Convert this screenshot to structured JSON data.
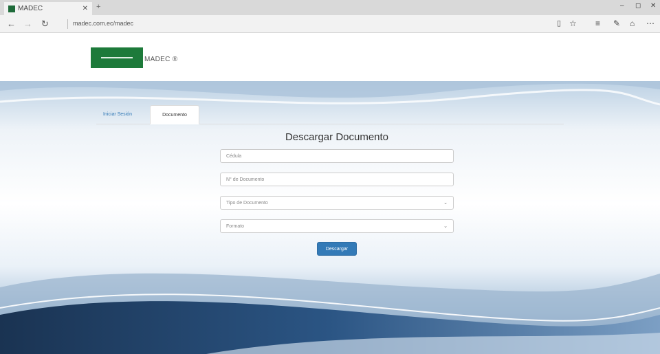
{
  "browser": {
    "tab_title": "MADEC",
    "url": "madec.com.ec/madec"
  },
  "header": {
    "brand": "MADEC ®"
  },
  "nav": {
    "tabs": [
      {
        "label": "Iniciar Sesión"
      },
      {
        "label": "Documento"
      }
    ]
  },
  "form": {
    "title": "Descargar Documento",
    "cedula_placeholder": "Cédula",
    "document_number_placeholder": "N° de Documento",
    "document_type_selected": "Tipo de Documento",
    "format_selected": "Formato",
    "submit_label": "Descargar"
  },
  "colors": {
    "brand_green": "#1d7a3a",
    "primary_button": "#337ab7",
    "wave_dark": "#1e3c5c"
  }
}
